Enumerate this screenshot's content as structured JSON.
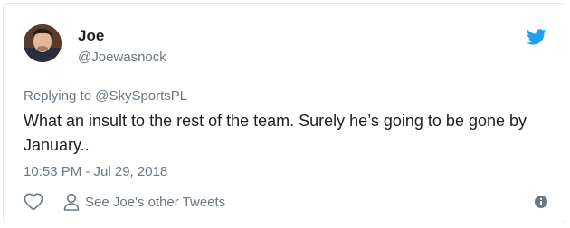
{
  "user": {
    "name": "Joe",
    "handle": "@Joewasnock"
  },
  "tweet": {
    "replying_prefix": "Replying to ",
    "replying_to": "@SkySportsPL",
    "text": "What an insult to the rest of the team. Surely he’s going to be gone by January..",
    "timestamp": "10:53 PM - Jul 29, 2018"
  },
  "actions": {
    "other_tweets_label": "See Joe's other Tweets"
  },
  "icons": {
    "brand": "twitter-bird-icon",
    "like": "heart-icon",
    "profile": "person-icon",
    "info": "info-icon"
  },
  "colors": {
    "twitter_blue": "#1da1f2",
    "muted": "#697882",
    "text": "#1c2022",
    "border": "#e1e8ed"
  }
}
